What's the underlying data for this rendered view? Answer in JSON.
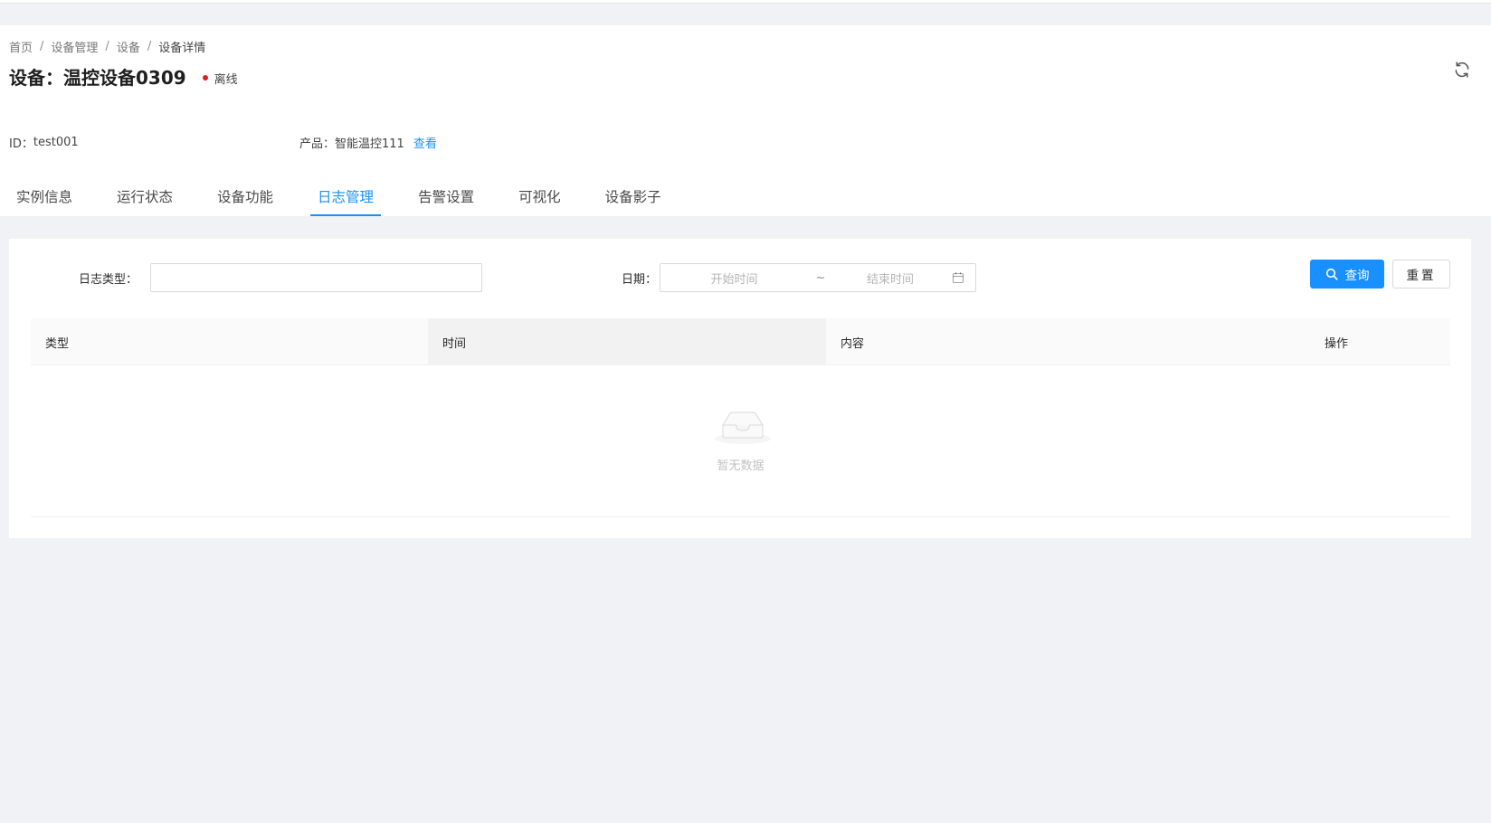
{
  "breadcrumb": {
    "items": [
      "首页",
      "设备管理",
      "设备",
      "设备详情"
    ],
    "separator": "/"
  },
  "device": {
    "title": "设备：温控设备0309",
    "status_label": "离线",
    "status_color": "#e11d1d",
    "id_label": "ID：",
    "id_value": "test001",
    "product_label": "产品：",
    "product_value": "智能温控111",
    "product_link": "查看"
  },
  "tabs": [
    {
      "label": "实例信息",
      "active": false
    },
    {
      "label": "运行状态",
      "active": false
    },
    {
      "label": "设备功能",
      "active": false
    },
    {
      "label": "日志管理",
      "active": true
    },
    {
      "label": "告警设置",
      "active": false
    },
    {
      "label": "可视化",
      "active": false
    },
    {
      "label": "设备影子",
      "active": false
    }
  ],
  "filters": {
    "log_type_label": "日志类型：",
    "log_type_value": "",
    "date_label": "日期：",
    "start_placeholder": "开始时间",
    "range_separator": "~",
    "end_placeholder": "结束时间",
    "search_label": "查询",
    "reset_label": "重置"
  },
  "table": {
    "columns": [
      "类型",
      "时间",
      "内容",
      "操作"
    ],
    "rows": [],
    "empty_text": "暂无数据"
  },
  "colors": {
    "primary": "#1890ff",
    "background": "#f0f2f5"
  },
  "icons": {
    "refresh": "refresh-icon",
    "search": "search-icon",
    "calendar": "calendar-icon",
    "empty": "empty-inbox-icon"
  }
}
